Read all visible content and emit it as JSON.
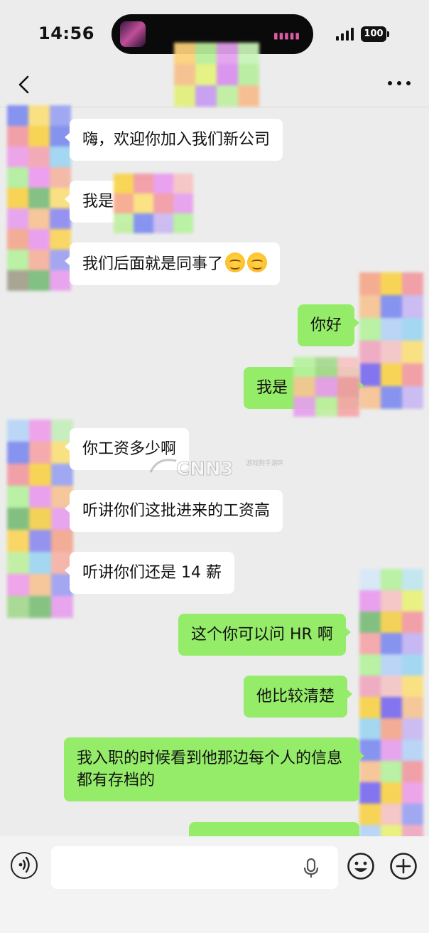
{
  "status_bar": {
    "time": "14:56",
    "battery": "100"
  },
  "chat": {
    "messages": [
      {
        "side": "in",
        "text": "嗨，欢迎你加入我们新公司"
      },
      {
        "side": "in",
        "text": "我是"
      },
      {
        "side": "in",
        "text": "我们后面就是同事了",
        "emoji": "smiling-face-icon"
      },
      {
        "side": "out",
        "text": "你好"
      },
      {
        "side": "out",
        "text": "我是"
      },
      {
        "side": "in",
        "text": "你工资多少啊"
      },
      {
        "side": "in",
        "text": "听讲你们这批进来的工资高"
      },
      {
        "side": "in",
        "text": "听讲你们还是 14 薪"
      },
      {
        "side": "out",
        "text": "这个你可以问 HR 啊"
      },
      {
        "side": "out",
        "text": "他比较清楚"
      },
      {
        "side": "out",
        "text": "我入职的时候看到他那边每个人的信息都有存档的"
      }
    ]
  },
  "watermark": {
    "text": "CNN3",
    "subtext": "游戏狗手游网"
  },
  "input_bar": {
    "placeholder": ""
  },
  "colors": {
    "background": "#ececec",
    "outgoing_bubble": "#95ec69",
    "incoming_bubble": "#ffffff"
  }
}
